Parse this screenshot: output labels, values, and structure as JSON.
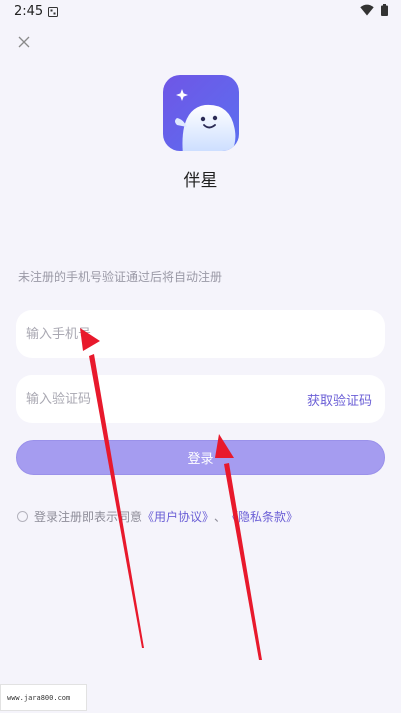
{
  "status_bar": {
    "time": "2:45"
  },
  "app": {
    "name": "伴星"
  },
  "login": {
    "hint": "未注册的手机号验证通过后将自动注册",
    "phone_placeholder": "输入手机号",
    "code_placeholder": "输入验证码",
    "get_code_label": "获取验证码",
    "login_label": "登录",
    "agree_text": "登录注册即表示同意",
    "user_agreement": "《用户协议》",
    "separator": "、",
    "privacy_policy": "《隐私条款》"
  },
  "watermark": {
    "text": "www.jara800.com"
  },
  "colors": {
    "background": "#f5f4fb",
    "accent": "#6b5fd6",
    "login_button": "#a59cf0",
    "annotation_arrow": "#e8192c"
  }
}
